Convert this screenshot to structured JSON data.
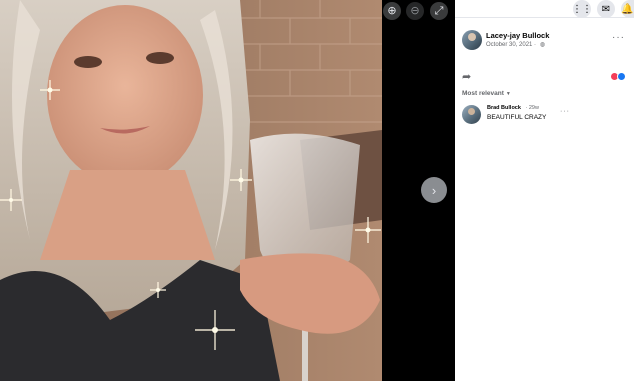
{
  "viewer": {
    "zoom_in_icon": "zoom-in-icon",
    "zoom_out_icon": "zoom-out-icon",
    "fullscreen_icon": "fullscreen-icon",
    "next_icon": "chevron-right-icon"
  },
  "topbar": {
    "menu_icon": "grid-menu-icon",
    "messenger_icon": "messenger-icon",
    "notifications_icon": "bell-icon"
  },
  "post": {
    "author": "Lacey-jay Bullock",
    "date": "October 30, 2021",
    "privacy_icon": "globe-icon",
    "more_icon": "more-dots-icon",
    "share_icon": "share-arrow-icon",
    "reactions": [
      "love",
      "like"
    ]
  },
  "comments": {
    "sort_label": "Most relevant",
    "items": [
      {
        "name": "Brad Bullock",
        "time": "29w",
        "text": "BEAUTIFUL CRAZY"
      }
    ]
  },
  "colors": {
    "viewer_bg": "#000000",
    "panel_bg": "#ffffff",
    "secondary_text": "#65676b",
    "love": "#f33e58",
    "like": "#1877f2"
  }
}
